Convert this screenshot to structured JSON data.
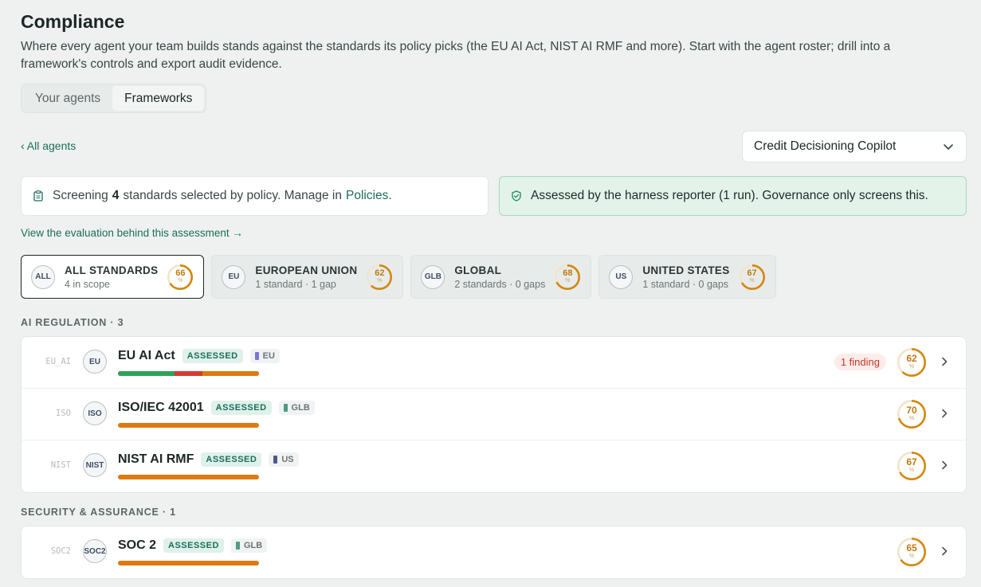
{
  "page": {
    "title": "Compliance",
    "subtitle": "Where every agent your team builds stands against the standards its policy picks (the EU AI Act, NIST AI RMF and more). Start with the agent roster; drill into a framework's controls and export audit evidence."
  },
  "tabs": [
    {
      "label": "Your agents",
      "active": false
    },
    {
      "label": "Frameworks",
      "active": true
    }
  ],
  "nav": {
    "back_label": "‹ All agents"
  },
  "agent_select": {
    "value": "Credit Decisioning Copilot",
    "icon": "chevron-down-icon"
  },
  "info": {
    "prefix": "Screening",
    "count": "4",
    "suffix": "standards selected by policy. Manage in",
    "link": "Policies",
    "tail": ".",
    "icon": "clipboard-icon"
  },
  "assessment": {
    "text": "Assessed by the harness reporter (1 run). Governance only screens this.",
    "icon": "shield-check-icon"
  },
  "eval_link": "View the evaluation behind this assessment →",
  "scopes": [
    {
      "flag": "ALL",
      "title": "ALL STANDARDS",
      "sub": "4 in scope",
      "score": 66,
      "pct": "%",
      "selected": true
    },
    {
      "flag": "EU",
      "title": "EUROPEAN UNION",
      "sub": "1 standard · 1 gap",
      "score": 62,
      "pct": "%",
      "selected": false
    },
    {
      "flag": "GLB",
      "title": "GLOBAL",
      "sub": "2 standards · 0 gaps",
      "score": 68,
      "pct": "%",
      "selected": false
    },
    {
      "flag": "US",
      "title": "UNITED STATES",
      "sub": "1 standard · 0 gaps",
      "score": 67,
      "pct": "%",
      "selected": false
    }
  ],
  "sections": [
    {
      "heading": "AI REGULATION · 3",
      "rows": [
        {
          "code": "EU_AI",
          "flag": "EU",
          "name": "EU AI Act",
          "badge": "ASSESSED",
          "region": "EU",
          "region_color": "#7b74d8",
          "finding": "1 finding",
          "score": 62,
          "pct": "%",
          "bar": [
            {
              "frac": 0.4,
              "color": "#2ea15a"
            },
            {
              "frac": 0.2,
              "color": "#d63a2f"
            },
            {
              "frac": 0.4,
              "color": "#dd7a12"
            }
          ]
        },
        {
          "code": "ISO",
          "flag": "ISO",
          "name": "ISO/IEC 42001",
          "badge": "ASSESSED",
          "region": "GLB",
          "region_color": "#4f9a86",
          "finding": "",
          "score": 70,
          "pct": "%",
          "bar": [
            {
              "frac": 1.0,
              "color": "#dd7a12"
            }
          ]
        },
        {
          "code": "NIST",
          "flag": "NIST",
          "name": "NIST AI RMF",
          "badge": "ASSESSED",
          "region": "US",
          "region_color": "#4a5a90",
          "finding": "",
          "score": 67,
          "pct": "%",
          "bar": [
            {
              "frac": 1.0,
              "color": "#dd7a12"
            }
          ]
        }
      ]
    },
    {
      "heading": "SECURITY & ASSURANCE · 1",
      "rows": [
        {
          "code": "SOC2",
          "flag": "SOC2",
          "name": "SOC 2",
          "badge": "ASSESSED",
          "region": "GLB",
          "region_color": "#4f9a86",
          "finding": "",
          "score": 65,
          "pct": "%",
          "bar": [
            {
              "frac": 1.0,
              "color": "#dd7a12"
            }
          ]
        }
      ]
    }
  ],
  "colors": {
    "ring": "#d4870f",
    "ring_track": "#f1e4cc",
    "accent": "#1b6e5a"
  }
}
